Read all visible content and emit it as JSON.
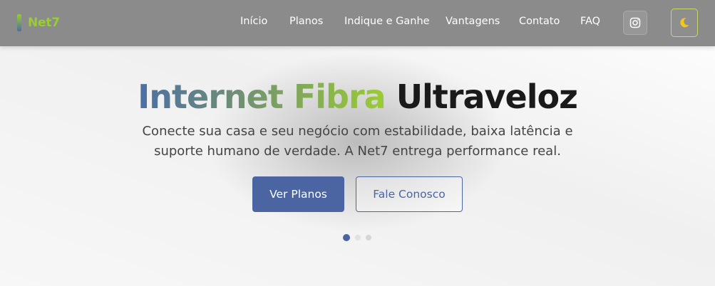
{
  "brand": {
    "name": "Net7"
  },
  "nav": {
    "items": [
      {
        "label": "Início"
      },
      {
        "label": "Planos"
      },
      {
        "label": "Indique e Ganhe"
      },
      {
        "label": "Vantagens"
      },
      {
        "label": "Contato"
      },
      {
        "label": "FAQ"
      }
    ],
    "instagram_icon": "instagram-icon",
    "theme_icon": "moon-icon"
  },
  "hero": {
    "title_part1": "Internet Fibra",
    "title_part2": "Ultraveloz",
    "subtitle": "Conecte sua casa e seu negócio com estabilidade, baixa latência e suporte humano de verdade. A Net7 entrega performance real.",
    "primary_button": "Ver Planos",
    "secondary_button": "Fale Conosco"
  },
  "carousel": {
    "slides": 3,
    "active": 1
  },
  "colors": {
    "accent_green": "#9acd32",
    "accent_blue": "#4a65a2",
    "navbar": "#8b8b8b"
  }
}
